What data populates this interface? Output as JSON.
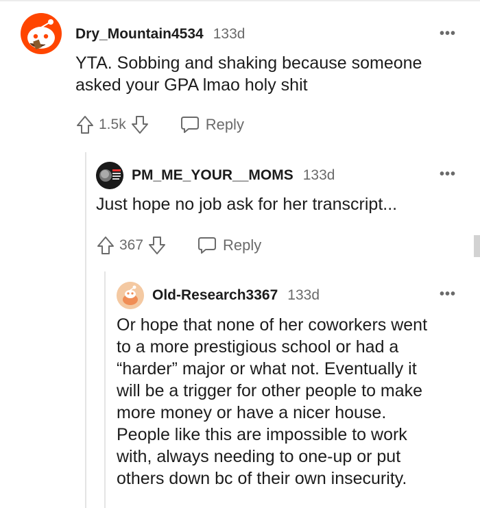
{
  "comments": [
    {
      "username": "Dry_Mountain4534",
      "age": "133d",
      "menu": "•••",
      "body": [
        "YTA. Sobbing and shaking because someone",
        "asked your GPA lmao holy shit"
      ],
      "votes": "1.5k",
      "reply_label": "Reply"
    },
    {
      "username": "PM_ME_YOUR__MOMS",
      "age": "133d",
      "menu": "•••",
      "body": [
        "Just hope no job ask for her transcript..."
      ],
      "votes": "367",
      "reply_label": "Reply"
    },
    {
      "username": "Old-Research3367",
      "age": "133d",
      "menu": "•••",
      "body": [
        "Or hope that none of her coworkers went",
        "to a more prestigious school or had a",
        "“harder” major or what not. Eventually it",
        "will be a trigger for other people to make",
        "more money or have a nicer house.",
        "People like this are impossible to work",
        "with, always needing to one-up or put",
        "others down bc of their own insecurity."
      ]
    }
  ],
  "colors": {
    "accent_orange": "#ff4500",
    "text_primary": "#1c1c1c",
    "text_secondary": "#6a6a6a",
    "thread_line": "#e4e4e4"
  },
  "icons": {
    "upvote": "arrow-up-outline",
    "downvote": "arrow-down-outline",
    "reply": "speech-bubble-outline",
    "menu": "ellipsis"
  }
}
